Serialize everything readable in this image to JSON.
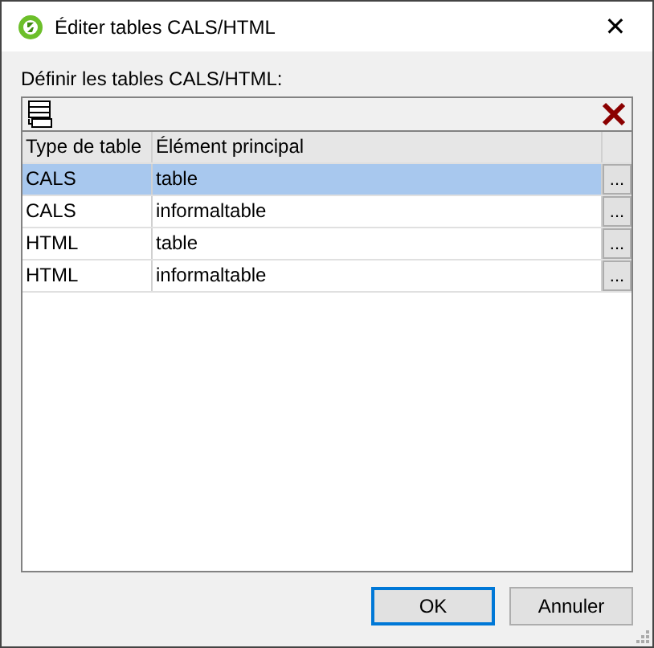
{
  "window": {
    "title": "Éditer tables CALS/HTML",
    "close": "✕"
  },
  "prompt": "Définir les tables CALS/HTML:",
  "table": {
    "columns": [
      "Type de table",
      "Élément principal"
    ],
    "rows": [
      {
        "type": "CALS",
        "element": "table",
        "button": "...",
        "selected": true
      },
      {
        "type": "CALS",
        "element": "informaltable",
        "button": "...",
        "selected": false
      },
      {
        "type": "HTML",
        "element": "table",
        "button": "...",
        "selected": false
      },
      {
        "type": "HTML",
        "element": "informaltable",
        "button": "...",
        "selected": false
      }
    ]
  },
  "buttons": [
    {
      "label": "OK",
      "kind": "default"
    },
    {
      "label": "Annuler",
      "kind": "normal"
    }
  ]
}
